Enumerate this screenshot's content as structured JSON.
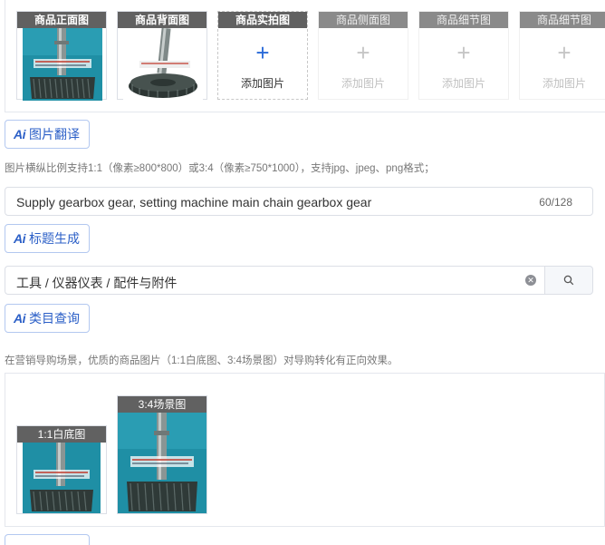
{
  "photos": {
    "slots": [
      {
        "label": "商品正面图",
        "state": "filled",
        "image": "gear-shaft-front"
      },
      {
        "label": "商品背面图",
        "state": "filled",
        "image": "gear-shaft-back"
      },
      {
        "label": "商品实拍图",
        "state": "empty",
        "add_label": "添加图片"
      },
      {
        "label": "商品侧面图",
        "state": "disabled",
        "add_label": "添加图片"
      },
      {
        "label": "商品细节图",
        "state": "disabled",
        "add_label": "添加图片"
      },
      {
        "label": "商品细节图",
        "state": "disabled",
        "add_label": "添加图片"
      }
    ]
  },
  "image_translate_button": {
    "ai": "Ai",
    "label": "图片翻译"
  },
  "image_hint": "图片横纵比例支持1:1（像素≥800*800）或3:4（像素≥750*1000），支持jpg、jpeg、png格式；",
  "title_field": {
    "value": "Supply gearbox gear, setting machine main chain gearbox gear",
    "count": "60/128"
  },
  "title_generate_button": {
    "ai": "Ai",
    "label": "标题生成"
  },
  "category_field": {
    "value": "工具 / 仪器仪表 / 配件与附件"
  },
  "category_query_button": {
    "ai": "Ai",
    "label": "类目查询"
  },
  "scene_hint": "在营销导购场景，优质的商品图片（1:1白底图、3:4场景图）对导购转化有正向效果。",
  "scene_images": [
    {
      "label": "1:1白底图",
      "image": "gear-shaft-white-bg"
    },
    {
      "label": "3:4场景图",
      "image": "gear-shaft-scene"
    }
  ],
  "colors": {
    "accent": "#2b5fc7",
    "label_bg": "#616161",
    "border": "#dcdfe6",
    "gear_dark": "#2f3a38",
    "photo_bg": "#1f8fa5"
  }
}
